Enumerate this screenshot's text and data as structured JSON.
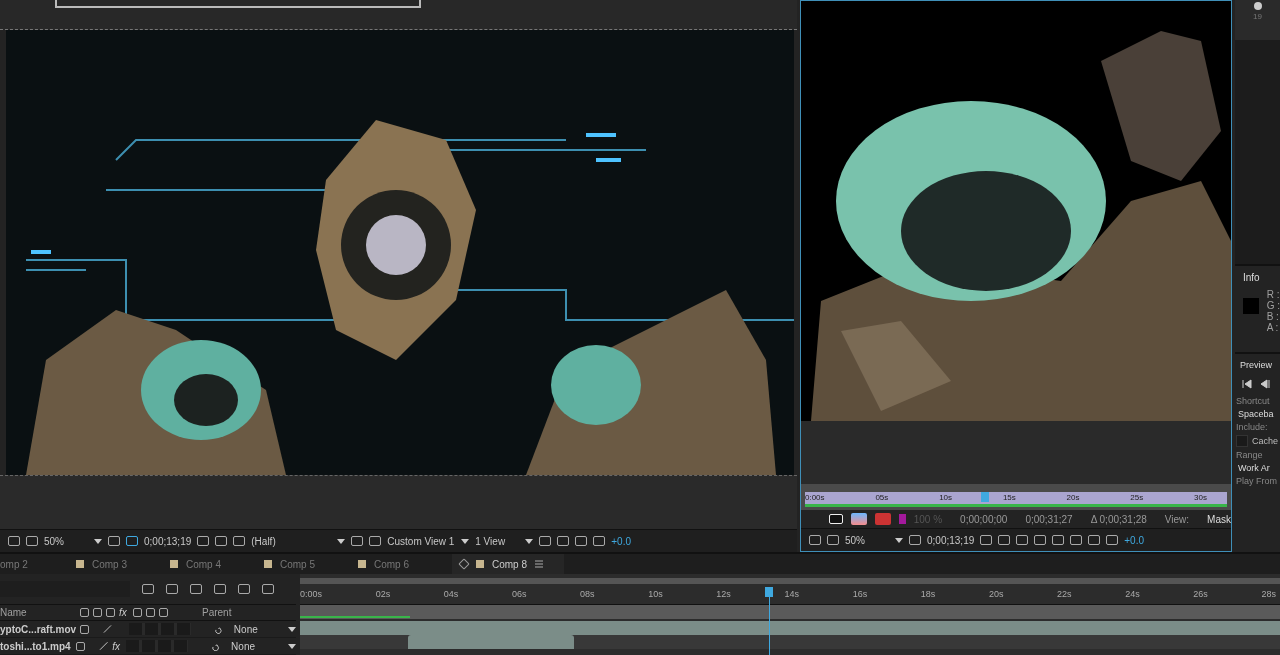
{
  "left_viewer": {
    "toolbar": {
      "zoom": "50%",
      "timecode": "0;00;13;19",
      "resolution": "(Half)",
      "view": "Custom View 1",
      "layout": "1 View",
      "exposure": "+0.0"
    }
  },
  "right_viewer": {
    "ruler": [
      "0:00s",
      "05s",
      "10s",
      "15s",
      "20s",
      "25s",
      "30s"
    ],
    "transport": {
      "opacity": "100 %",
      "start": "0;00;00;00",
      "end": "0;00;31;27",
      "duration": "Δ 0;00;31;28",
      "view_label": "View:",
      "view_value": "Mask"
    },
    "toolbar": {
      "zoom": "50%",
      "timecode": "0;00;13;19",
      "exposure": "+0.0"
    }
  },
  "side_panel": {
    "top_label": "19",
    "info": {
      "title": "Info",
      "channels": [
        "R :",
        "G :",
        "B :",
        "A :"
      ]
    },
    "preview": {
      "title": "Preview",
      "shortcut_label": "Shortcut",
      "shortcut": "Spaceba",
      "include_label": "Include:",
      "cache": {
        "label": "Cache",
        "checked": false
      },
      "range_label": "Range",
      "range": "Work Ar",
      "play_from": "Play From"
    }
  },
  "tabs": [
    {
      "label": "omp 2",
      "selected": false
    },
    {
      "label": "Comp 3",
      "selected": false
    },
    {
      "label": "Comp 4",
      "selected": false
    },
    {
      "label": "Comp 5",
      "selected": false
    },
    {
      "label": "Comp 6",
      "selected": false
    },
    {
      "label": "Comp 8",
      "selected": true
    }
  ],
  "timeline": {
    "name_column": "Name",
    "fx_column": "fx",
    "parent_column": "Parent",
    "ruler": [
      "0:00s",
      "02s",
      "04s",
      "06s",
      "08s",
      "10s",
      "12s",
      "14s",
      "16s",
      "18s",
      "20s",
      "22s",
      "24s",
      "26s",
      "28s"
    ],
    "layers": [
      {
        "name": "yptoC...raft.mov",
        "parent": "None"
      },
      {
        "name": "toshi...to1.mp4",
        "fx": "fx",
        "parent": "None"
      }
    ]
  }
}
